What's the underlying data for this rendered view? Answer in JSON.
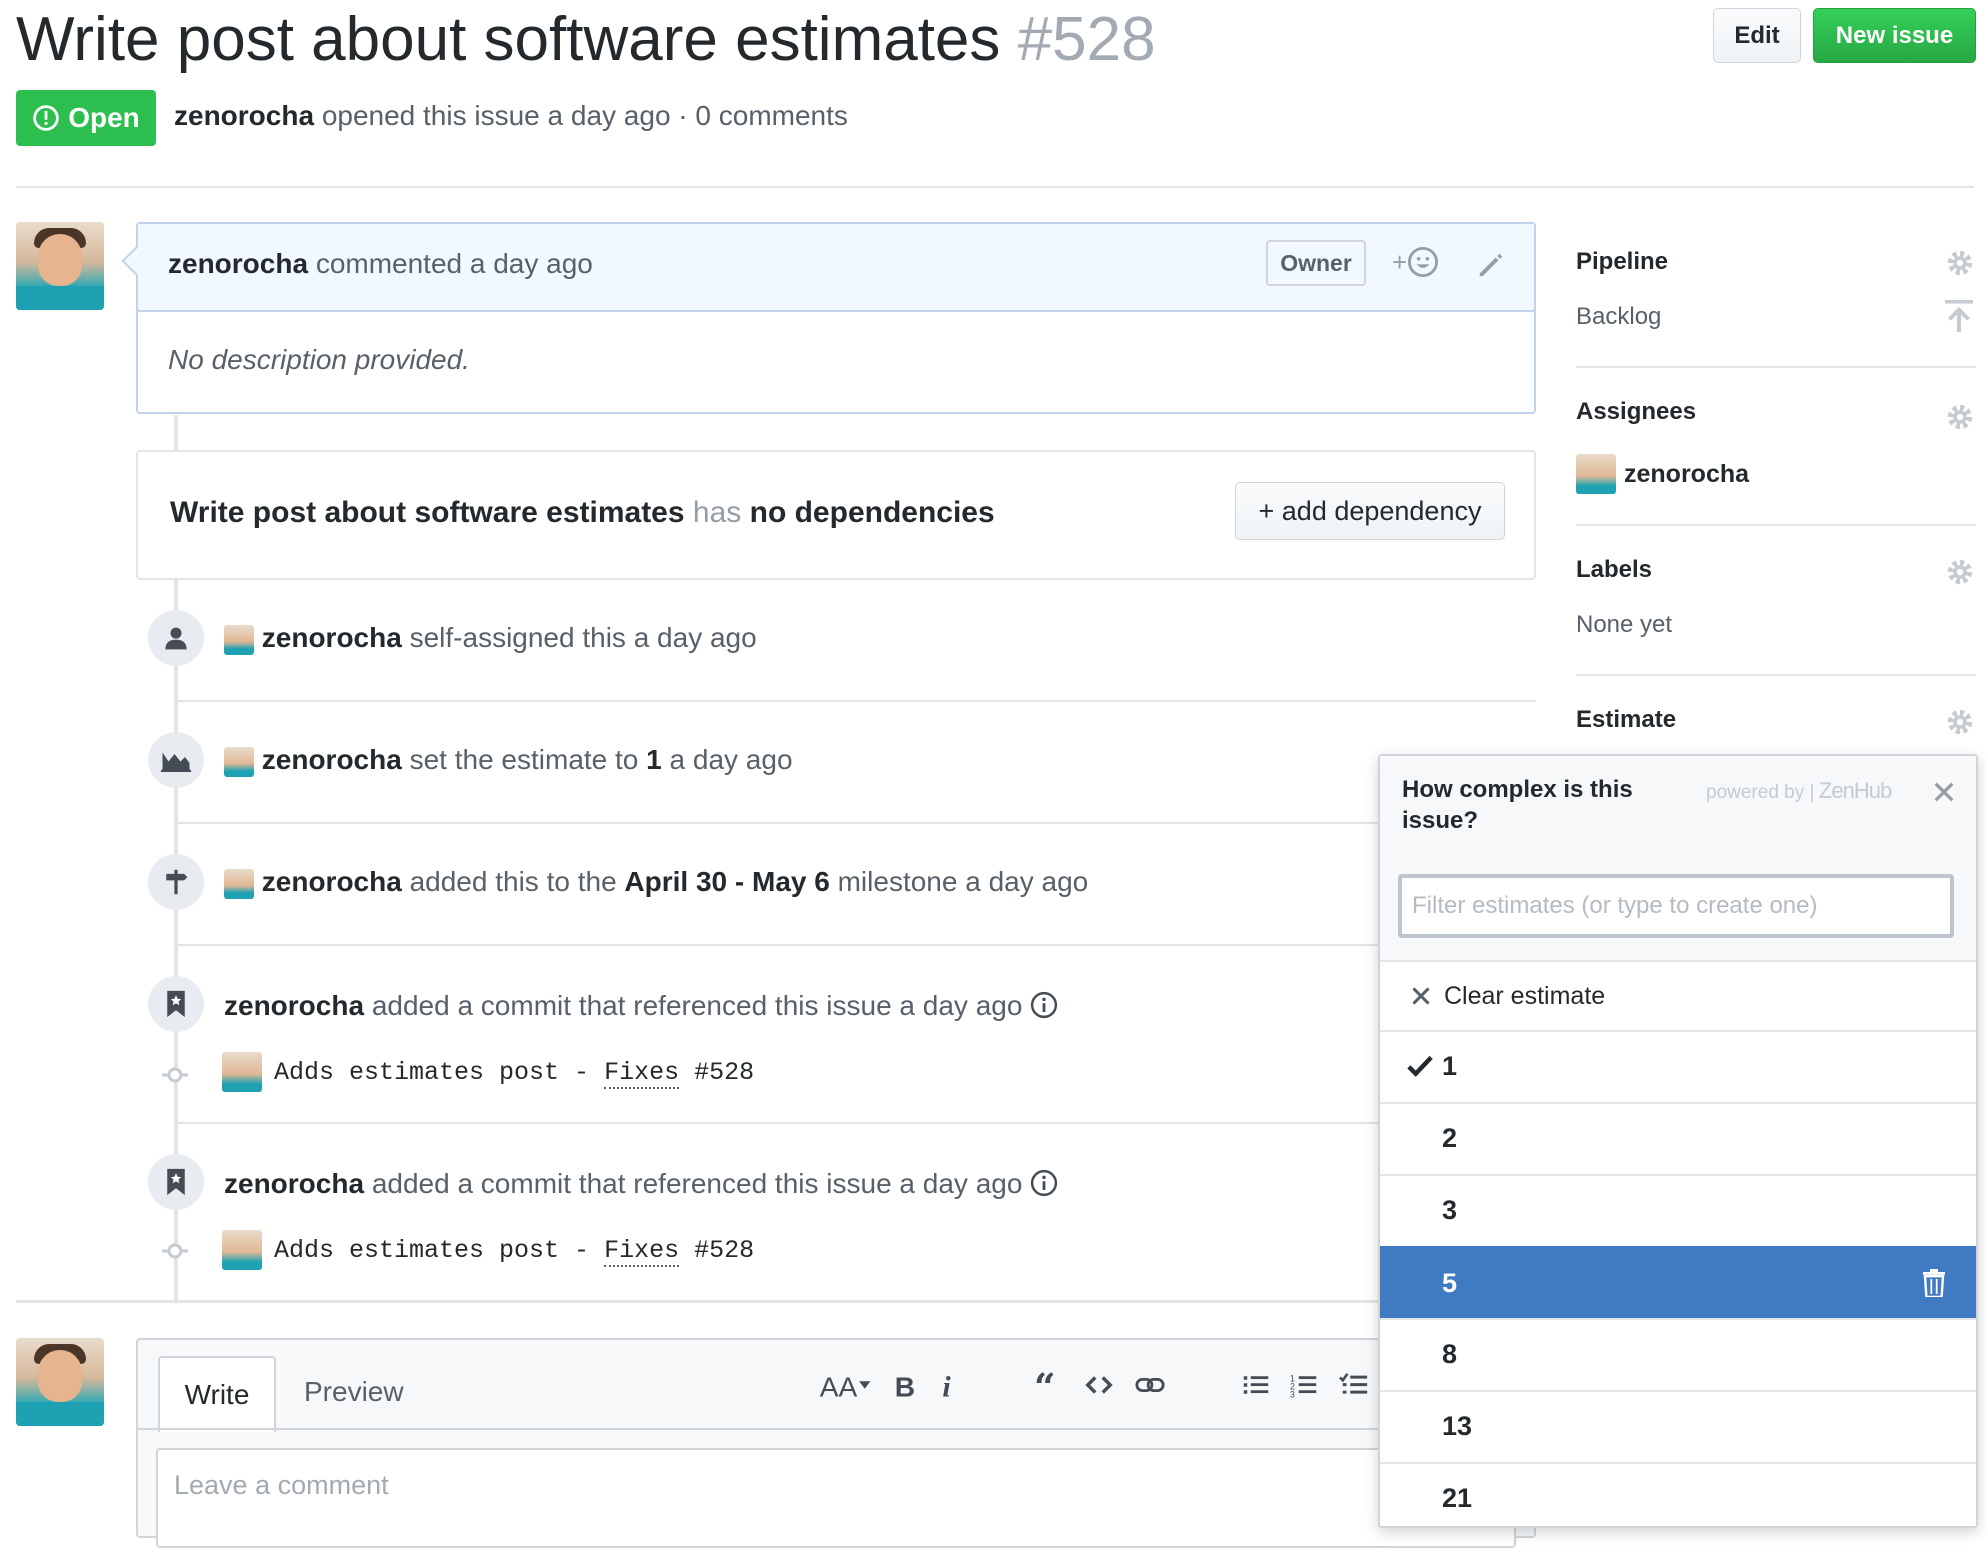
{
  "issue": {
    "title": "Write post about software estimates",
    "number": "#528",
    "state": "Open",
    "author": "zenorocha",
    "meta": "opened this issue a day ago · 0 comments"
  },
  "header": {
    "edit_label": "Edit",
    "new_issue_label": "New issue"
  },
  "comment": {
    "author": "zenorocha",
    "time": "commented a day ago",
    "badge": "Owner",
    "reaction_plus": "+",
    "body": "No description provided."
  },
  "dependency": {
    "title": "Write post about software estimates",
    "has": "has",
    "none": "no dependencies",
    "add_label": "+ add dependency"
  },
  "events": [
    {
      "user": "zenorocha",
      "text": "self-assigned this a day ago"
    },
    {
      "user": "zenorocha",
      "pre": "set the estimate to",
      "value": "1",
      "post": "a day ago"
    },
    {
      "user": "zenorocha",
      "pre": "added this to the",
      "milestone": "April 30 - May 6",
      "post": "milestone a day ago"
    },
    {
      "user": "zenorocha",
      "text": "added a commit that referenced this issue a day ago",
      "commit_pre": "Adds estimates post - ",
      "commit_link": "Fixes",
      "commit_ref": " #528"
    },
    {
      "user": "zenorocha",
      "text": "added a commit that referenced this issue a day ago",
      "commit_pre": "Adds estimates post - ",
      "commit_link": "Fixes",
      "commit_ref": " #528"
    }
  ],
  "editor": {
    "tab_write": "Write",
    "tab_preview": "Preview",
    "placeholder": "Leave a comment"
  },
  "sidebar": {
    "pipeline_h": "Pipeline",
    "pipeline_v": "Backlog",
    "assignees_h": "Assignees",
    "assignee": "zenorocha",
    "labels_h": "Labels",
    "labels_v": "None yet",
    "estimate_h": "Estimate"
  },
  "estimate_popup": {
    "question": "How complex is this issue?",
    "powered_by": "powered by |",
    "brand": "ZenHub",
    "filter_placeholder": "Filter estimates (or type to create one)",
    "clear_label": "Clear estimate",
    "options": [
      "1",
      "2",
      "3",
      "5",
      "8",
      "13",
      "21"
    ],
    "selected": "1",
    "highlighted": "5"
  },
  "colors": {
    "open_green": "#2cbe4e",
    "highlight_blue": "#3f7ac2",
    "comment_header_bg": "#f1f8ff",
    "comment_border": "#c0d3eb"
  }
}
